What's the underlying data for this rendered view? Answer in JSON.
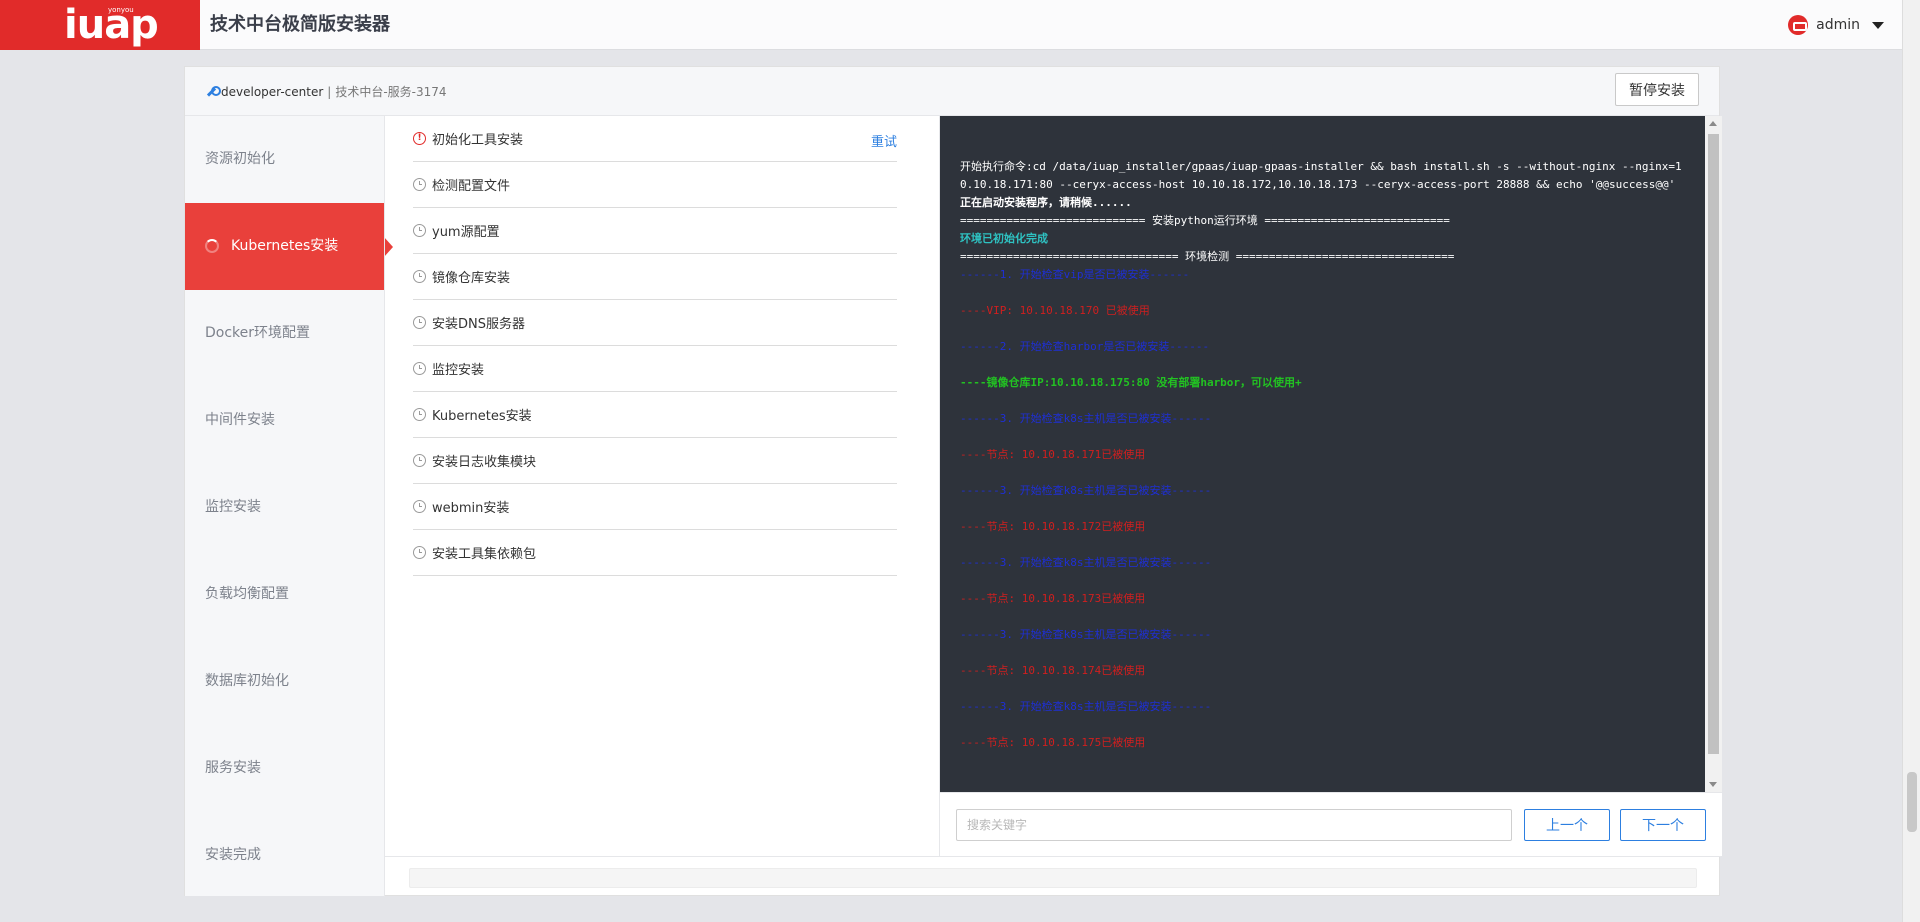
{
  "header": {
    "logo_text": "iuap",
    "logo_small": "yonyou",
    "title": "技术中台极简版安装器",
    "user_name": "admin"
  },
  "card": {
    "breadcrumb_main": "developer-center",
    "breadcrumb_sep": " | ",
    "breadcrumb_sub": "技术中台-服务-3174",
    "pause_label": "暂停安装"
  },
  "steps": [
    {
      "label": "资源初始化",
      "active": false
    },
    {
      "label": "Kubernetes安装",
      "active": true
    },
    {
      "label": "Docker环境配置",
      "active": false
    },
    {
      "label": "中间件安装",
      "active": false
    },
    {
      "label": "监控安装",
      "active": false
    },
    {
      "label": "负载均衡配置",
      "active": false
    },
    {
      "label": "数据库初始化",
      "active": false
    },
    {
      "label": "服务安装",
      "active": false
    },
    {
      "label": "安装完成",
      "active": false
    }
  ],
  "tasks": [
    {
      "label": "初始化工具安装",
      "status": "error"
    },
    {
      "label": "检测配置文件",
      "status": "pending"
    },
    {
      "label": "yum源配置",
      "status": "pending"
    },
    {
      "label": "镜像仓库安装",
      "status": "pending"
    },
    {
      "label": "安装DNS服务器",
      "status": "pending"
    },
    {
      "label": "监控安装",
      "status": "pending"
    },
    {
      "label": "Kubernetes安装",
      "status": "pending"
    },
    {
      "label": "安装日志收集模块",
      "status": "pending"
    },
    {
      "label": "webmin安装",
      "status": "pending"
    },
    {
      "label": "安装工具集依赖包",
      "status": "pending"
    }
  ],
  "retry_label": "重试",
  "log_lines": [
    {
      "text": "开始执行命令:cd /data/iuap_installer/gpaas/iuap-gpaas-installer && bash install.sh -s --without-nginx --nginx=10.10.18.171:80 --ceryx-access-host 10.10.18.172,10.10.18.173 --ceryx-access-port 28888 && echo '@@success@@'",
      "style": "white"
    },
    {
      "text": "正在启动安装程序，请稍候......",
      "style": "bold"
    },
    {
      "text": "============================ 安装python运行环境 ============================",
      "style": "white"
    },
    {
      "text": "环境已初始化完成",
      "style": "cyan"
    },
    {
      "text": "================================= 环境检测 =================================",
      "style": "white"
    },
    {
      "text": "------1. 开始检查vip是否已被安装------",
      "style": "blue"
    },
    {
      "text": "",
      "style": "gap"
    },
    {
      "text": "----VIP: 10.10.18.170 已被使用",
      "style": "red"
    },
    {
      "text": "",
      "style": "gap"
    },
    {
      "text": "------2. 开始检查harbor是否已被安装------",
      "style": "blue"
    },
    {
      "text": "",
      "style": "gap"
    },
    {
      "text": "----镜像仓库IP:10.10.18.175:80 没有部署harbor，可以使用+",
      "style": "green"
    },
    {
      "text": "",
      "style": "gap"
    },
    {
      "text": "------3. 开始检查k8s主机是否已被安装------",
      "style": "blue"
    },
    {
      "text": "",
      "style": "gap"
    },
    {
      "text": "----节点: 10.10.18.171已被使用",
      "style": "red"
    },
    {
      "text": "",
      "style": "gap"
    },
    {
      "text": "------3. 开始检查k8s主机是否已被安装------",
      "style": "blue"
    },
    {
      "text": "",
      "style": "gap"
    },
    {
      "text": "----节点: 10.10.18.172已被使用",
      "style": "red"
    },
    {
      "text": "",
      "style": "gap"
    },
    {
      "text": "------3. 开始检查k8s主机是否已被安装------",
      "style": "blue"
    },
    {
      "text": "",
      "style": "gap"
    },
    {
      "text": "----节点: 10.10.18.173已被使用",
      "style": "red"
    },
    {
      "text": "",
      "style": "gap"
    },
    {
      "text": "------3. 开始检查k8s主机是否已被安装------",
      "style": "blue"
    },
    {
      "text": "",
      "style": "gap"
    },
    {
      "text": "----节点: 10.10.18.174已被使用",
      "style": "red"
    },
    {
      "text": "",
      "style": "gap"
    },
    {
      "text": "------3. 开始检查k8s主机是否已被安装------",
      "style": "blue"
    },
    {
      "text": "",
      "style": "gap"
    },
    {
      "text": "----节点: 10.10.18.175已被使用",
      "style": "red"
    }
  ],
  "search": {
    "placeholder": "搜索关键字",
    "value": "",
    "prev_label": "上一个",
    "next_label": "下一个"
  },
  "progress": {
    "percent": 0
  },
  "colors": {
    "brand_red": "#e12b2a",
    "active_step": "#e9403b",
    "link_blue": "#2d7fe0",
    "terminal_bg": "#2e333b"
  },
  "icons": {
    "user": "user-avatar-icon",
    "breadcrumb": "wrench-icon",
    "task_pending": "clock-icon",
    "task_error": "error-circle-icon",
    "step_running": "spinner-icon"
  }
}
